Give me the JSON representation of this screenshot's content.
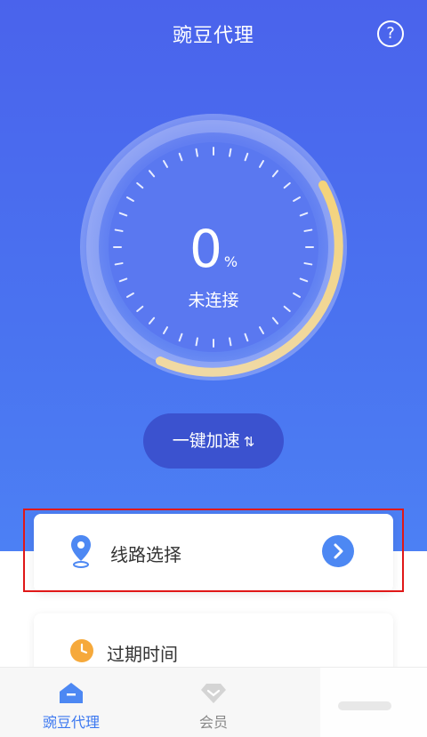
{
  "header": {
    "title": "豌豆代理",
    "help_symbol": "?"
  },
  "gauge": {
    "percent": "0",
    "percent_unit": "%",
    "status": "未连接",
    "progress_fraction": 0.25
  },
  "accelerate_button": {
    "label": "一键加速",
    "arrow_symbol": "⇅"
  },
  "cards": {
    "route": {
      "label": "线路选择"
    },
    "expiry": {
      "label": "过期时间"
    }
  },
  "bottom_nav": [
    {
      "label": "豌豆代理",
      "active": true
    },
    {
      "label": "会员",
      "active": false
    }
  ],
  "colors": {
    "primary": "#4a63ec",
    "accent_blue": "#3c78f0",
    "gauge_yellow": "#f3d27c",
    "clock_orange": "#f6a93b",
    "highlight_red": "#e01818"
  }
}
